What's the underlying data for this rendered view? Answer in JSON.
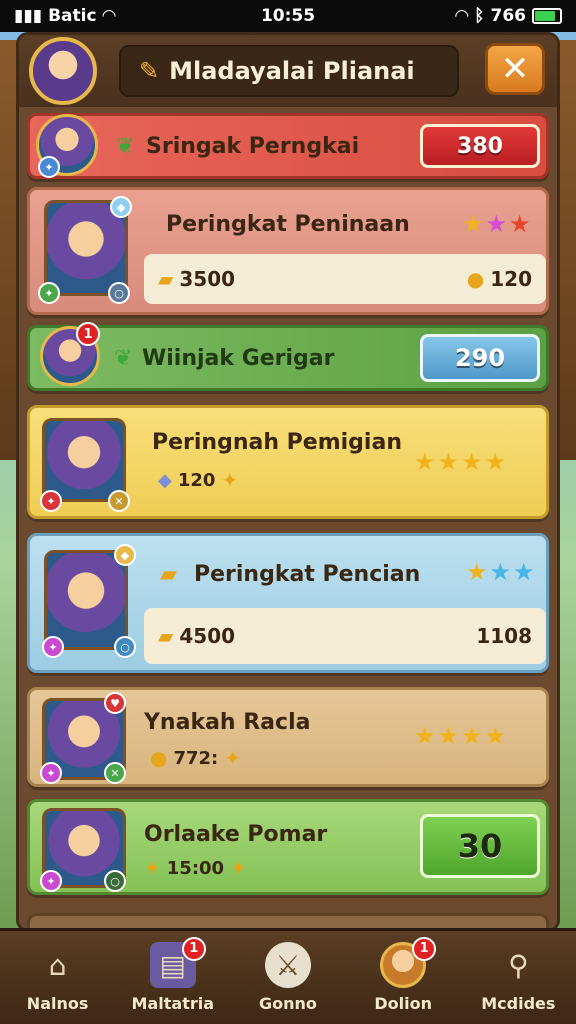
{
  "status_bar": {
    "carrier": "Batic",
    "time": "10:55",
    "battery_text": "766"
  },
  "header": {
    "title": "Mladayalai Plianai",
    "close_label": "✕"
  },
  "rows": [
    {
      "name": "Sringak Perngkai",
      "score": "380"
    },
    {
      "name": "Peringkat Peninaan",
      "left_value": "3500",
      "right_value": "120"
    },
    {
      "name": "Wiinjak Gerigar",
      "score": "290",
      "notification": "1"
    },
    {
      "name": "Peringnah Pemigian",
      "value": "120"
    },
    {
      "name": "Peringkat Pencian",
      "left_value": "4500",
      "right_value": "1108"
    },
    {
      "name": "Ynakah Racla",
      "value": "772:"
    },
    {
      "name": "Orlaake Pomar",
      "value": "15:00",
      "score": "30"
    }
  ],
  "bottom_nav": [
    {
      "label": "Nalnos",
      "icon": "home-icon"
    },
    {
      "label": "Maltatria",
      "icon": "scroll-icon",
      "notification": "1"
    },
    {
      "label": "Gonno",
      "icon": "sword-icon"
    },
    {
      "label": "Dolion",
      "icon": "hero-icon",
      "notification": "1"
    },
    {
      "label": "Mcdides",
      "icon": "search-icon"
    }
  ],
  "colors": {
    "red_button": "#d9262b",
    "blue_button": "#5aa9d8",
    "green_button": "#5cb83a",
    "row_red": "#e25b4f",
    "row_yellow": "#f5d86a",
    "row_blue": "#a9d1e6",
    "row_tan": "#e2c08d",
    "row_green": "#9ad36a"
  }
}
